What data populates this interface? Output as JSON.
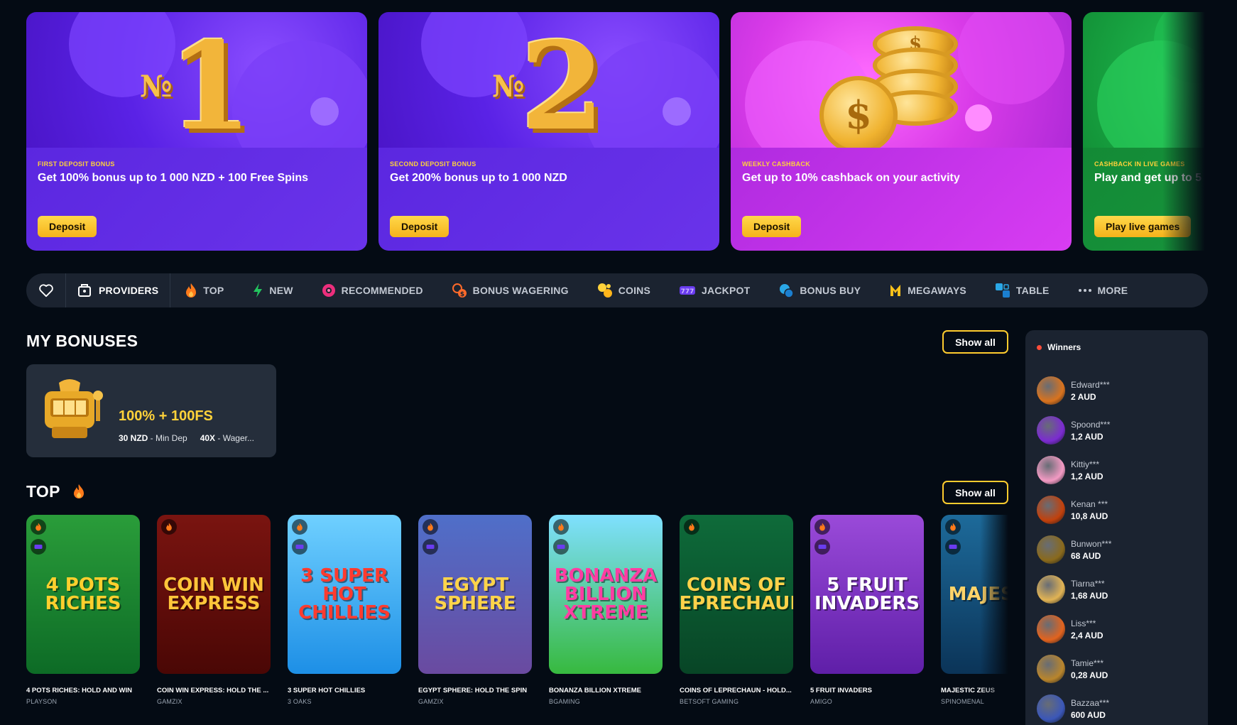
{
  "promos": [
    {
      "kicker": "FIRST DEPOSIT BONUS",
      "headline": "Get 100% bonus up to 1 000 NZD + 100 Free Spins",
      "button": "Deposit",
      "art_text": "1",
      "art_prefix": "№"
    },
    {
      "kicker": "SECOND DEPOSIT BONUS",
      "headline": "Get 200% bonus up to 1 000 NZD",
      "button": "Deposit",
      "art_text": "2",
      "art_prefix": "№"
    },
    {
      "kicker": "WEEKLY CASHBACK",
      "headline": "Get up to 10% cashback on your activity",
      "button": "Deposit",
      "art_text": "$"
    },
    {
      "kicker": "CASHBACK IN LIVE GAMES",
      "headline": "Play and get up to 5",
      "button": "Play live games"
    }
  ],
  "categories": {
    "providers": "PROVIDERS",
    "items": [
      {
        "label": "TOP",
        "icon": "fire-icon"
      },
      {
        "label": "NEW",
        "icon": "lightning-icon"
      },
      {
        "label": "RECOMMENDED",
        "icon": "recommended-icon"
      },
      {
        "label": "BONUS WAGERING",
        "icon": "bonus-wagering-icon"
      },
      {
        "label": "COINS",
        "icon": "coins-icon"
      },
      {
        "label": "JACKPOT",
        "icon": "jackpot-icon"
      },
      {
        "label": "BONUS BUY",
        "icon": "bonus-buy-icon"
      },
      {
        "label": "MEGAWAYS",
        "icon": "megaways-icon"
      },
      {
        "label": "TABLE",
        "icon": "table-icon"
      },
      {
        "label": "MORE",
        "icon": "more-icon"
      }
    ]
  },
  "my_bonuses": {
    "title": "MY BONUSES",
    "show_all": "Show all",
    "card": {
      "title": "100% + 100FS",
      "min_dep_value": "30 NZD",
      "min_dep_label": " - Min Dep",
      "wager_value": "40X",
      "wager_label": " - Wager..."
    }
  },
  "top": {
    "title": "TOP",
    "show_all": "Show all",
    "games": [
      {
        "name": "4 POTS RICHES: HOLD AND WIN",
        "provider": "PLAYSON",
        "logo": "4 POTS RICHES",
        "bg": "linear-gradient(180deg,#2a9d3a,#0d6b26)",
        "fg": "#ffcf2e"
      },
      {
        "name": "COIN WIN EXPRESS: HOLD THE ...",
        "provider": "GAMZIX",
        "logo": "COIN WIN EXPRESS",
        "bg": "linear-gradient(180deg,#7a1410,#4a0705)",
        "fg": "#ffc53a"
      },
      {
        "name": "3 SUPER HOT CHILLIES",
        "provider": "3 OAKS",
        "logo": "3 SUPER HOT CHILLIES",
        "bg": "linear-gradient(180deg,#6fd0ff,#1d8fe6)",
        "fg": "#ff3b2f"
      },
      {
        "name": "EGYPT SPHERE: HOLD THE SPIN",
        "provider": "GAMZIX",
        "logo": "EGYPT SPHERE",
        "bg": "linear-gradient(180deg,#4f6fc9,#6a4aa0)",
        "fg": "#ffd44a"
      },
      {
        "name": "BONANZA BILLION XTREME",
        "provider": "BGAMING",
        "logo": "BONANZA BILLION XTREME",
        "bg": "linear-gradient(180deg,#7fe0ff,#37b93f)",
        "fg": "#ff3da3"
      },
      {
        "name": "COINS OF LEPRECHAUN - HOLD...",
        "provider": "BETSOFT GAMING",
        "logo": "COINS OF LEPRECHAUN",
        "bg": "linear-gradient(180deg,#0e6b3a,#084526)",
        "fg": "#ffd24a"
      },
      {
        "name": "5 FRUIT INVADERS",
        "provider": "AMIGO",
        "logo": "5 FRUIT INVADERS",
        "bg": "linear-gradient(180deg,#9a4ad9,#5f1fa8)",
        "fg": "#ffffff"
      },
      {
        "name": "MAJESTIC ZEUS",
        "provider": "SPINOMENAL",
        "logo": "MAJESTIC",
        "bg": "linear-gradient(180deg,#1d6a9a,#0b3458)",
        "fg": "#ffd46a"
      }
    ]
  },
  "winners": {
    "title": "Winners",
    "items": [
      {
        "name": "Edward***",
        "amount": "2 AUD",
        "color": "#d9731e"
      },
      {
        "name": "Spoond***",
        "amount": "1,2 AUD",
        "color": "#7b2bd1"
      },
      {
        "name": "Kittiy***",
        "amount": "1,2 AUD",
        "color": "#f39ac3"
      },
      {
        "name": "Kenan ***",
        "amount": "10,8 AUD",
        "color": "#c2410c"
      },
      {
        "name": "Bunwon***",
        "amount": "68 AUD",
        "color": "#8a6a1c"
      },
      {
        "name": "Tiarna***",
        "amount": "1,68 AUD",
        "color": "#e1b354"
      },
      {
        "name": "Liss***",
        "amount": "2,4 AUD",
        "color": "#e2631e"
      },
      {
        "name": "Tamie***",
        "amount": "0,28 AUD",
        "color": "#b9852c"
      },
      {
        "name": "Bazzaa***",
        "amount": "600 AUD",
        "color": "#3b57b8"
      }
    ]
  },
  "colors": {
    "accent": "#ffcc2e",
    "bar": "#1b2330",
    "bg": "#040b14"
  }
}
